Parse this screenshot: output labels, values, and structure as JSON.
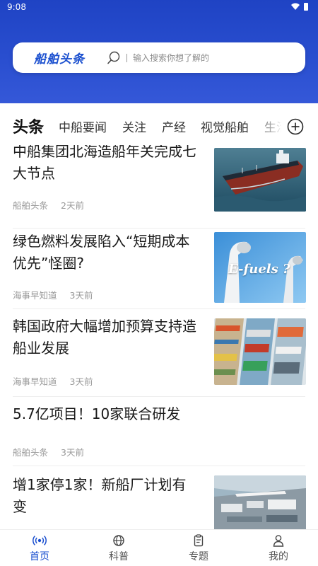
{
  "status_bar": {
    "time": "9:08"
  },
  "search": {
    "brand": "船舶头条",
    "placeholder": "输入搜索你想了解的"
  },
  "tabs": [
    {
      "label": "头条",
      "active": true
    },
    {
      "label": "中船要闻"
    },
    {
      "label": "关注"
    },
    {
      "label": "产经"
    },
    {
      "label": "视觉船舶"
    },
    {
      "label": "生活"
    }
  ],
  "feed": [
    {
      "title": "中船集团北海造船年关完成七大节点",
      "source": "船舶头条",
      "ago": "2天前",
      "image": "ship-photo"
    },
    {
      "title": "绿色燃料发展陷入“短期成本优先”怪圈?",
      "source": "海事早知道",
      "ago": "3天前",
      "image": "e-fuels-illustration",
      "image_text": "E-fuels ?"
    },
    {
      "title": "韩国政府大幅增加预算支持造船业发展",
      "source": "海事早知道",
      "ago": "3天前",
      "image": "shipyard-collage"
    },
    {
      "title": "5.7亿项目！10家联合研发",
      "source": "船舶头条",
      "ago": "3天前"
    },
    {
      "title": "增1家停1家！新船厂计划有变",
      "source": "",
      "ago": "",
      "image": "shipyard-aerial"
    }
  ],
  "bottom_nav": [
    {
      "label": "首页",
      "icon": "radio-wave-icon",
      "active": true
    },
    {
      "label": "科普",
      "icon": "globe-icon"
    },
    {
      "label": "专题",
      "icon": "clipboard-icon"
    },
    {
      "label": "我的",
      "icon": "person-icon"
    }
  ],
  "colors": {
    "brand_blue": "#1a4fcf",
    "header_blue": "#2a4fd0"
  }
}
